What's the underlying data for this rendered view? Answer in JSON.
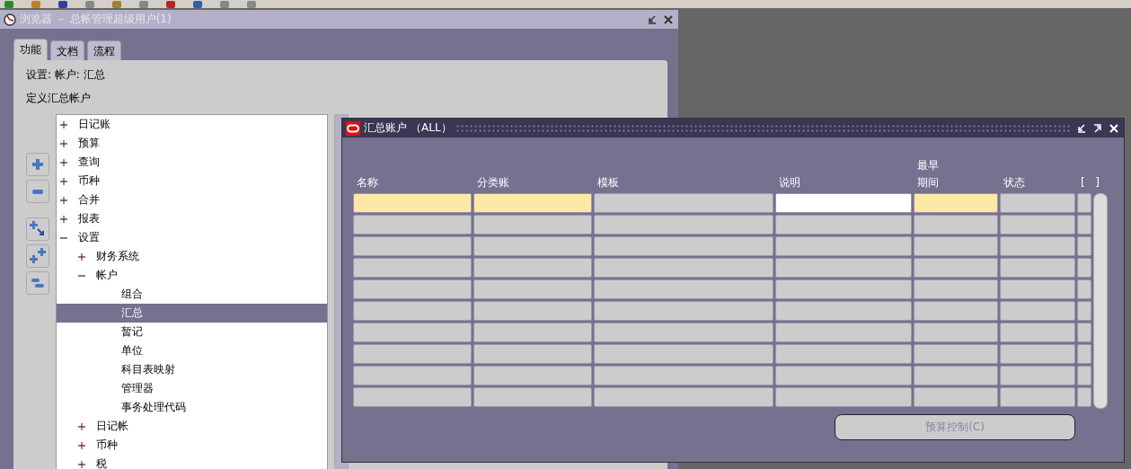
{
  "navigator": {
    "title": "浏览器 － 总帐管理超级用户(1)",
    "tabs": [
      {
        "label": "功能",
        "selected": true
      },
      {
        "label": "文档",
        "selected": false
      },
      {
        "label": "流程",
        "selected": false
      }
    ],
    "path": "设置: 帐户: 汇总",
    "description": "定义汇总帐户",
    "tree": [
      {
        "label": "日记账",
        "expanded": false,
        "kind": "folder",
        "selected": false
      },
      {
        "label": "预算",
        "expanded": false,
        "kind": "folder",
        "selected": false
      },
      {
        "label": "查询",
        "expanded": false,
        "kind": "folder",
        "selected": false
      },
      {
        "label": "币种",
        "expanded": false,
        "kind": "folder",
        "selected": false
      },
      {
        "label": "合并",
        "expanded": false,
        "kind": "folder",
        "selected": false
      },
      {
        "label": "报表",
        "expanded": false,
        "kind": "folder",
        "selected": false
      },
      {
        "label": "设置",
        "expanded": true,
        "kind": "folder",
        "selected": false,
        "children": [
          {
            "label": "财务系统",
            "expanded": false,
            "kind": "folder",
            "selected": false
          },
          {
            "label": "帐户",
            "expanded": true,
            "kind": "folder",
            "selected": false,
            "children": [
              {
                "label": "组合",
                "kind": "leaf",
                "selected": false
              },
              {
                "label": "汇总",
                "kind": "leaf",
                "selected": true
              },
              {
                "label": "暂记",
                "kind": "leaf",
                "selected": false
              },
              {
                "label": "单位",
                "kind": "leaf",
                "selected": false
              },
              {
                "label": "科目表映射",
                "kind": "leaf",
                "selected": false
              },
              {
                "label": "管理器",
                "kind": "leaf",
                "selected": false
              },
              {
                "label": "事务处理代码",
                "kind": "leaf",
                "selected": false
              }
            ]
          },
          {
            "label": "日记帐",
            "expanded": false,
            "kind": "folder",
            "selected": false
          },
          {
            "label": "币种",
            "expanded": false,
            "kind": "folder",
            "selected": false
          },
          {
            "label": "税",
            "expanded": false,
            "kind": "folder",
            "selected": false
          }
        ]
      }
    ]
  },
  "dialog": {
    "title": "汇总账户",
    "badge": "（ALL）",
    "columns": [
      {
        "lines": [
          "名称"
        ],
        "required": true,
        "focused": false
      },
      {
        "lines": [
          "分类账"
        ],
        "required": true,
        "focused": false
      },
      {
        "lines": [
          "模板"
        ],
        "required": false,
        "focused": false
      },
      {
        "lines": [
          "说明"
        ],
        "required": false,
        "focused": true
      },
      {
        "lines": [
          "最早",
          "期间"
        ],
        "required": true,
        "focused": false
      },
      {
        "lines": [
          "状态"
        ],
        "required": false,
        "focused": false
      },
      {
        "lines": [
          "[   ]"
        ],
        "required": false,
        "focused": false
      }
    ],
    "rows": [
      {
        "selected": true
      },
      {
        "selected": false
      },
      {
        "selected": false
      },
      {
        "selected": false
      },
      {
        "selected": false
      },
      {
        "selected": false
      },
      {
        "selected": false
      },
      {
        "selected": false
      },
      {
        "selected": false
      },
      {
        "selected": false
      }
    ],
    "button": {
      "label": "预算控制(C)",
      "disabled": true
    }
  }
}
